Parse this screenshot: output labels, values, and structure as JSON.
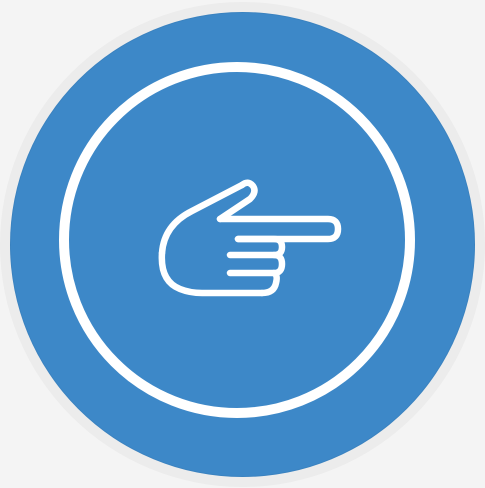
{
  "icon": {
    "name": "pointing-hand-icon",
    "direction": "right"
  },
  "colors": {
    "background": "#f4f4f4",
    "halo": "#ececec",
    "badge": "#3d88c8",
    "stroke": "#ffffff"
  }
}
